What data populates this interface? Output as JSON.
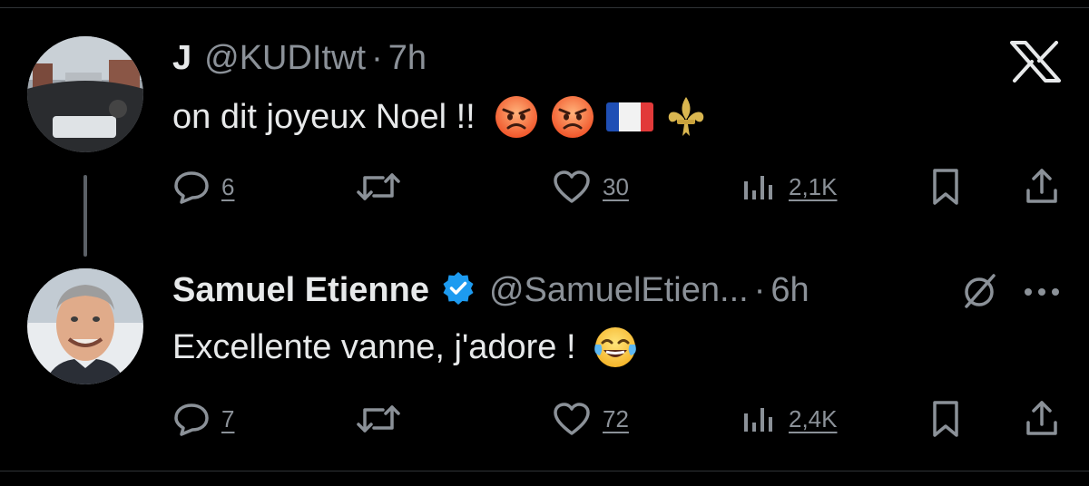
{
  "tweets": [
    {
      "name": "J",
      "handle": "@KUDItwt",
      "time": "7h",
      "text": "on dit joyeux Noel !!",
      "emojis": [
        "angry-face",
        "angry-face",
        "france-flag",
        "fleur-de-lis"
      ],
      "stats": {
        "replies": "6",
        "retweets": "",
        "likes": "30",
        "views": "2,1K"
      }
    },
    {
      "name": "Samuel Etienne",
      "verified": true,
      "handle": "@SamuelEtien...",
      "time": "6h",
      "text": "Excellente vanne, j'adore !",
      "emojis": [
        "face-with-tears-of-joy"
      ],
      "stats": {
        "replies": "7",
        "retweets": "",
        "likes": "72",
        "views": "2,4K"
      }
    }
  ],
  "colors": {
    "background": "#000000",
    "text": "#e7e9ea",
    "secondary": "#8b9198",
    "verified": "#1d9bf0"
  },
  "icons": [
    "x-logo-icon",
    "reply-icon",
    "retweet-icon",
    "like-icon",
    "views-icon",
    "bookmark-icon",
    "share-icon",
    "verified-badge-icon",
    "grok-icon",
    "more-icon"
  ]
}
